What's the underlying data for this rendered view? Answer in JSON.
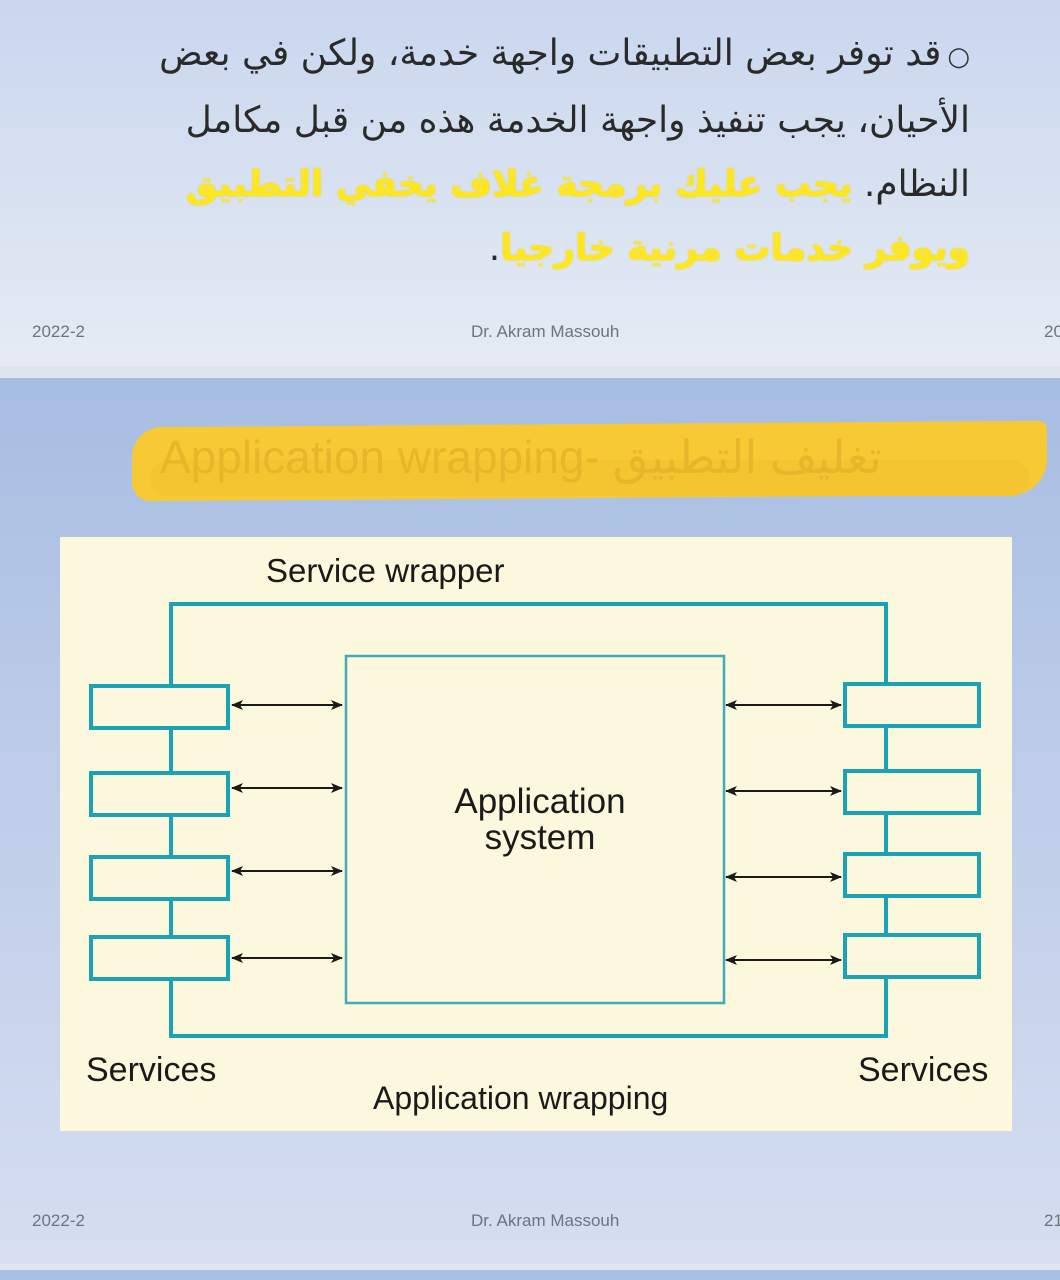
{
  "slide_top": {
    "bullet": "○",
    "text_plain": "قد توفر بعض التطبيقات واجهة خدمة، ولكن في بعض الأحيان، يجب تنفيذ واجهة الخدمة هذه من قبل مكامل النظام. ",
    "text_highlight": "يجب عليك برمجة غلاف يخفي التطبيق ويوفر خدمات مرنية خارجيا",
    "text_end": ".",
    "footer_left": "2022-2",
    "footer_center": "Dr. Akram Massouh",
    "footer_right": "20"
  },
  "slide_bottom": {
    "title": "Application wrapping-   تغليف التطبيق",
    "figure": {
      "wrapper_label": "Service wrapper",
      "core_label_line1": "Application",
      "core_label_line2": "system",
      "left_label": "Services",
      "right_label": "Services",
      "caption": "Application wrapping"
    },
    "footer_left": "2022-2",
    "footer_center": "Dr. Akram Massouh",
    "footer_right": "21"
  },
  "colors": {
    "diagram_stroke": "#1ba3b3",
    "core_stroke": "#43a9b8",
    "highlight": "#ffe71f",
    "title_band": "#f7c934"
  }
}
